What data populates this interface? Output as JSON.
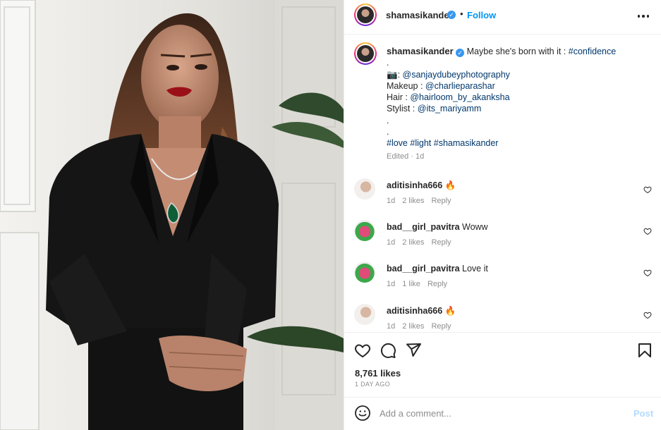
{
  "post": {
    "username": "shamasikander",
    "verified_badge": "✓",
    "separator": "•",
    "follow_label": "Follow",
    "more_icon": "more-horizontal-icon"
  },
  "caption": {
    "username": "shamasikander",
    "text": "Maybe she's born with it : ",
    "hashtag1": "#confidence",
    "dot1": ".",
    "camera_icon": "📷",
    "colon": ": ",
    "photographer": "@sanjaydubeyphotography",
    "makeup_label": "Makeup : ",
    "makeup": "@charlieparashar",
    "hair_label": "Hair : ",
    "hair": "@hairloom_by_akanksha",
    "stylist_label": "Stylist : ",
    "stylist": "@its_mariyamm",
    "dot2": ".",
    "dot3": ".",
    "tags": [
      "#love",
      "#light",
      "#shamasikander"
    ],
    "edited": "Edited",
    "middot": "·",
    "age": "1d"
  },
  "comments": [
    {
      "username": "aditisinha666",
      "text": "🔥",
      "age": "1d",
      "likes": "2 likes",
      "reply": "Reply"
    },
    {
      "username": "bad__girl_pavitra",
      "text": "Woww",
      "age": "1d",
      "likes": "2 likes",
      "reply": "Reply"
    },
    {
      "username": "bad__girl_pavitra",
      "text": "Love it",
      "age": "1d",
      "likes": "1 like",
      "reply": "Reply"
    },
    {
      "username": "aditisinha666",
      "text": "🔥",
      "age": "1d",
      "likes": "2 likes",
      "reply": "Reply"
    }
  ],
  "actions": {
    "like_icon": "heart-icon",
    "comment_icon": "comment-bubble-icon",
    "share_icon": "paper-plane-icon",
    "save_icon": "bookmark-icon",
    "likes_count": "8,761 likes",
    "date": "1 DAY AGO"
  },
  "add_comment": {
    "emoji_icon": "emoji-smile-icon",
    "placeholder": "Add a comment...",
    "post_label": "Post"
  },
  "colors": {
    "accent": "#0095f6",
    "link": "#00376b",
    "muted": "#8e8e8e",
    "post_disabled": "#b3dbff"
  }
}
